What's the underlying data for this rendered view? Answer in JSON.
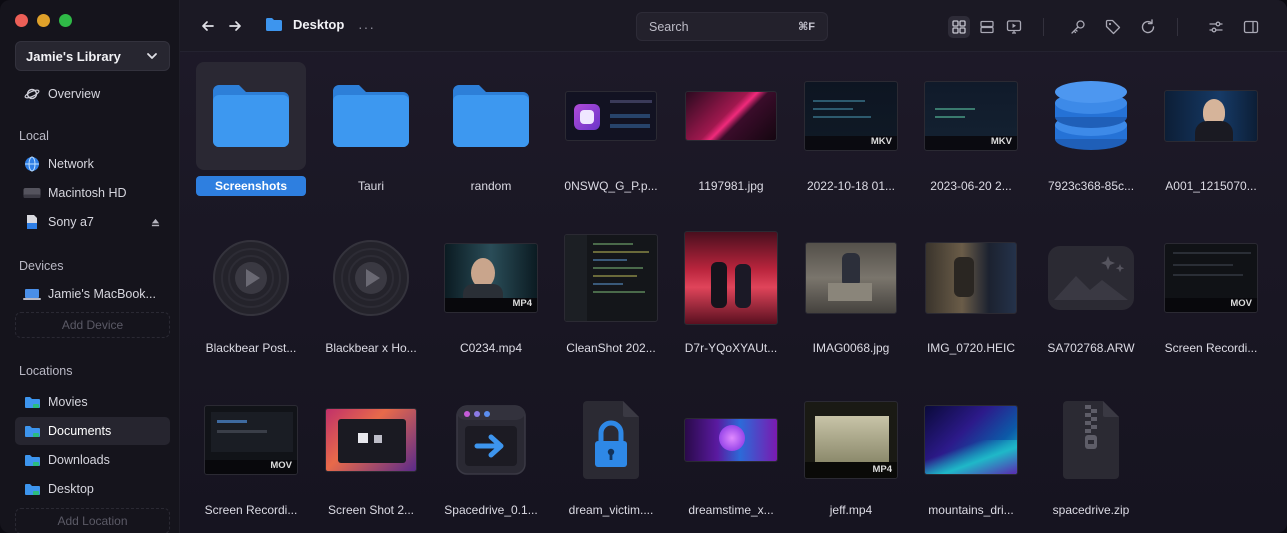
{
  "sidebar": {
    "library": "Jamie's Library",
    "overview": "Overview",
    "local_header": "Local",
    "local": [
      "Network",
      "Macintosh HD",
      "Sony a7"
    ],
    "devices_header": "Devices",
    "device": "Jamie's MacBook...",
    "add_device": "Add Device",
    "locations_header": "Locations",
    "locations": [
      "Movies",
      "Documents",
      "Downloads",
      "Desktop"
    ],
    "add_location": "Add Location"
  },
  "topbar": {
    "breadcrumb": "Desktop",
    "more": "···",
    "search_placeholder": "Search",
    "search_shortcut": "⌘F"
  },
  "files": [
    {
      "name": "Screenshots",
      "kind": "folder",
      "selected": true
    },
    {
      "name": "Tauri",
      "kind": "folder"
    },
    {
      "name": "random",
      "kind": "folder"
    },
    {
      "name": "0NSWQ_G_P.p...",
      "kind": "image"
    },
    {
      "name": "1197981.jpg",
      "kind": "image"
    },
    {
      "name": "2022-10-18 01...",
      "kind": "video",
      "badge": "MKV"
    },
    {
      "name": "2023-06-20 2...",
      "kind": "video",
      "badge": "MKV"
    },
    {
      "name": "7923c368-85c...",
      "kind": "database"
    },
    {
      "name": "A001_1215070...",
      "kind": "image"
    },
    {
      "name": "Blackbear Post...",
      "kind": "audio"
    },
    {
      "name": "Blackbear x Ho...",
      "kind": "audio"
    },
    {
      "name": "C0234.mp4",
      "kind": "video",
      "badge": "MP4"
    },
    {
      "name": "CleanShot 202...",
      "kind": "image"
    },
    {
      "name": "D7r-YQoXYAUt...",
      "kind": "image"
    },
    {
      "name": "IMAG0068.jpg",
      "kind": "image"
    },
    {
      "name": "IMG_0720.HEIC",
      "kind": "image"
    },
    {
      "name": "SA702768.ARW",
      "kind": "raw"
    },
    {
      "name": "Screen Recordi...",
      "kind": "video",
      "badge": "MOV"
    },
    {
      "name": "Screen Recordi...",
      "kind": "video",
      "badge": "MOV"
    },
    {
      "name": "Screen Shot 2...",
      "kind": "image"
    },
    {
      "name": "Spacedrive_0.1...",
      "kind": "installer"
    },
    {
      "name": "dream_victim....",
      "kind": "locked"
    },
    {
      "name": "dreamstime_x...",
      "kind": "image"
    },
    {
      "name": "jeff.mp4",
      "kind": "video",
      "badge": "MP4"
    },
    {
      "name": "mountains_dri...",
      "kind": "image"
    },
    {
      "name": "spacedrive.zip",
      "kind": "archive"
    }
  ],
  "colors": {
    "accent": "#2e7fe0",
    "folder": "#3d95ee",
    "sidebar": "#15141c"
  }
}
